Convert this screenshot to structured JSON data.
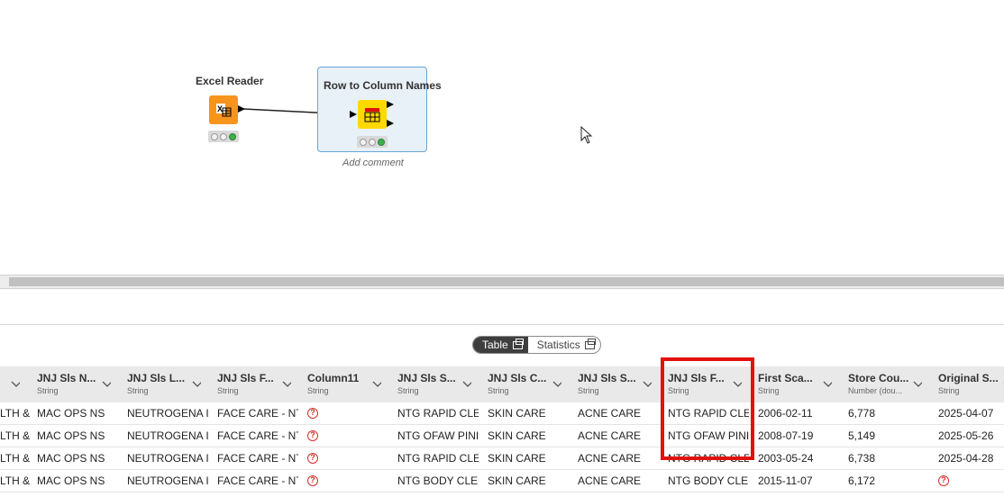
{
  "canvas": {
    "nodes": [
      {
        "title": "Excel Reader",
        "icon": "excel-reader-icon",
        "color": "#f7941d"
      },
      {
        "title": "Row to Column Names",
        "icon": "row-to-column-icon",
        "color": "#ffd800"
      }
    ],
    "add_comment": "Add comment"
  },
  "view_toggle": {
    "table": "Table",
    "statistics": "Statistics",
    "active": "Table"
  },
  "table": {
    "columns": [
      {
        "name": "...",
        "type": ""
      },
      {
        "name": "JNJ Sls N...",
        "type": "String"
      },
      {
        "name": "JNJ Sls L...",
        "type": "String"
      },
      {
        "name": "JNJ Sls F...",
        "type": "String"
      },
      {
        "name": "Column11",
        "type": "String"
      },
      {
        "name": "JNJ Sls S...",
        "type": "String"
      },
      {
        "name": "JNJ Sls C...",
        "type": "String"
      },
      {
        "name": "JNJ Sls S...",
        "type": "String"
      },
      {
        "name": "JNJ Sls F...",
        "type": "String"
      },
      {
        "name": "First Sca...",
        "type": "String"
      },
      {
        "name": "Store Cou...",
        "type": "Number (dou..."
      },
      {
        "name": "Original S...",
        "type": "String"
      }
    ],
    "rows": [
      [
        "LTH &",
        "MAC OPS NS",
        "NEUTROGENA I",
        "FACE CARE - NT",
        "?",
        "NTG RAPID CLE",
        "SKIN CARE",
        "ACNE CARE",
        "NTG RAPID CLE",
        "2006-02-11",
        "6,778",
        "2025-04-07"
      ],
      [
        "LTH &",
        "MAC OPS NS",
        "NEUTROGENA I",
        "FACE CARE - NT",
        "?",
        "NTG OFAW PINI",
        "SKIN CARE",
        "ACNE CARE",
        "NTG OFAW PINI",
        "2008-07-19",
        "5,149",
        "2025-05-26"
      ],
      [
        "LTH &",
        "MAC OPS NS",
        "NEUTROGENA I",
        "FACE CARE - NT",
        "?",
        "NTG RAPID CLE",
        "SKIN CARE",
        "ACNE CARE",
        "NTG RAPID CLE",
        "2003-05-24",
        "6,738",
        "2025-04-28"
      ],
      [
        "LTH &",
        "MAC OPS NS",
        "NEUTROGENA I",
        "FACE CARE - NT",
        "?",
        "NTG BODY CLE.",
        "SKIN CARE",
        "ACNE CARE",
        "NTG BODY CLE.",
        "2015-11-07",
        "6,172",
        "?"
      ]
    ]
  },
  "colors": {
    "highlight": "#e0120f",
    "missing": "#d0342c",
    "status_green": "#3bb44a"
  }
}
